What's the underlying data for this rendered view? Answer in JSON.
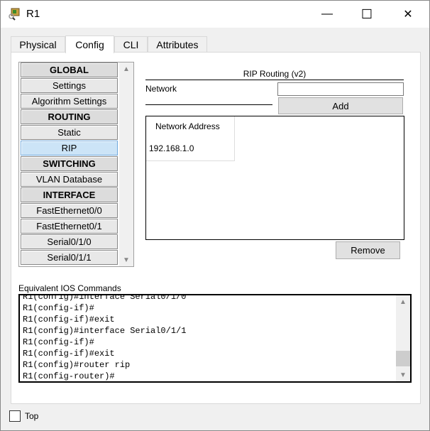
{
  "window": {
    "title": "R1",
    "minimize": "—",
    "maximize": "☐",
    "close": "✕"
  },
  "tabs": [
    {
      "label": "Physical"
    },
    {
      "label": "Config"
    },
    {
      "label": "CLI"
    },
    {
      "label": "Attributes"
    }
  ],
  "active_tab": "Config",
  "sidebar": {
    "items": [
      {
        "label": "GLOBAL",
        "header": true
      },
      {
        "label": "Settings"
      },
      {
        "label": "Algorithm Settings"
      },
      {
        "label": "ROUTING",
        "header": true
      },
      {
        "label": "Static"
      },
      {
        "label": "RIP",
        "selected": true
      },
      {
        "label": "SWITCHING",
        "header": true
      },
      {
        "label": "VLAN Database"
      },
      {
        "label": "INTERFACE",
        "header": true
      },
      {
        "label": "FastEthernet0/0"
      },
      {
        "label": "FastEthernet0/1"
      },
      {
        "label": "Serial0/1/0"
      },
      {
        "label": "Serial0/1/1"
      }
    ]
  },
  "rip": {
    "title": "RIP Routing (v2)",
    "network_label": "Network",
    "network_value": "",
    "add_label": "Add",
    "table": {
      "header": "Network Address",
      "rows": [
        "192.168.1.0"
      ]
    },
    "remove_label": "Remove"
  },
  "ios": {
    "label": "Equivalent IOS Commands",
    "lines": [
      "R1(config)#interface Serial0/1/0",
      "R1(config-if)#",
      "R1(config-if)#exit",
      "R1(config)#interface Serial0/1/1",
      "R1(config-if)#",
      "R1(config-if)#exit",
      "R1(config)#router rip",
      "R1(config-router)#"
    ]
  },
  "top_checkbox": {
    "label": "Top",
    "checked": false
  }
}
